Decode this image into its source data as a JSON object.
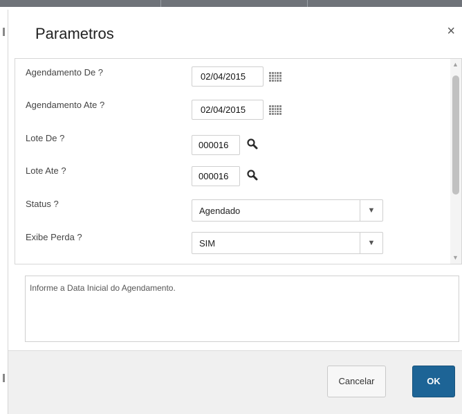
{
  "dialog": {
    "title": "Parametros",
    "close_glyph": "×"
  },
  "params": [
    {
      "label": "Agendamento De ?",
      "value": "02/04/2015",
      "control": "date",
      "icon": "calendar-icon"
    },
    {
      "label": "Agendamento Ate ?",
      "value": "02/04/2015",
      "control": "date",
      "icon": "calendar-icon"
    },
    {
      "label": "Lote De ?",
      "value": "000016",
      "control": "lookup",
      "icon": "search-icon"
    },
    {
      "label": "Lote Ate ?",
      "value": "000016",
      "control": "lookup",
      "icon": "search-icon"
    },
    {
      "label": "Status ?",
      "value": "Agendado",
      "control": "select"
    },
    {
      "label": "Exibe Perda ?",
      "value": "SIM",
      "control": "select"
    }
  ],
  "scrollbar": {
    "up_glyph": "▲",
    "down_glyph": "▼"
  },
  "select_arrow_glyph": "▼",
  "help": {
    "text": "Informe a Data Inicial do Agendamento."
  },
  "footer": {
    "cancel_label": "Cancelar",
    "ok_label": "OK"
  },
  "colors": {
    "primary_button": "#1d6496",
    "footer_background": "#f0f0f0"
  }
}
